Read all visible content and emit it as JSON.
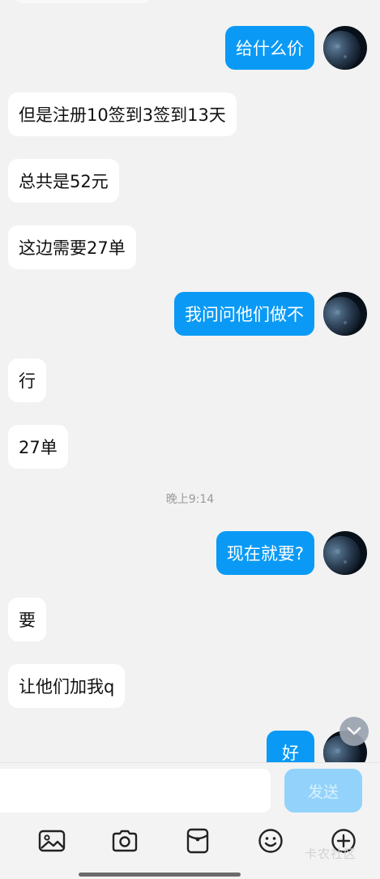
{
  "messages": [
    {
      "side": "out",
      "text": "给什么价"
    },
    {
      "side": "in",
      "text": "但是注册10签到3签到13天"
    },
    {
      "side": "in",
      "text": "总共是52元"
    },
    {
      "side": "in",
      "text": "这边需要27单"
    },
    {
      "side": "out",
      "text": "我问问他们做不"
    },
    {
      "side": "in",
      "text": "行"
    },
    {
      "side": "in",
      "text": "27单"
    },
    {
      "side": "out",
      "text": "现在就要?"
    },
    {
      "side": "in",
      "text": "要"
    },
    {
      "side": "in",
      "text": "让他们加我q"
    },
    {
      "side": "out",
      "text": "好"
    }
  ],
  "timestamp": "晚上9:14",
  "composer": {
    "send_label": "发送",
    "placeholder": ""
  },
  "toolbar_icons": [
    "image-icon",
    "camera-icon",
    "red-packet-icon",
    "emoji-icon",
    "plus-icon"
  ],
  "watermark": "卡农社区",
  "colors": {
    "outgoing_bubble": "#0a9af5",
    "incoming_bubble": "#ffffff",
    "send_button": "#93d3fb"
  }
}
